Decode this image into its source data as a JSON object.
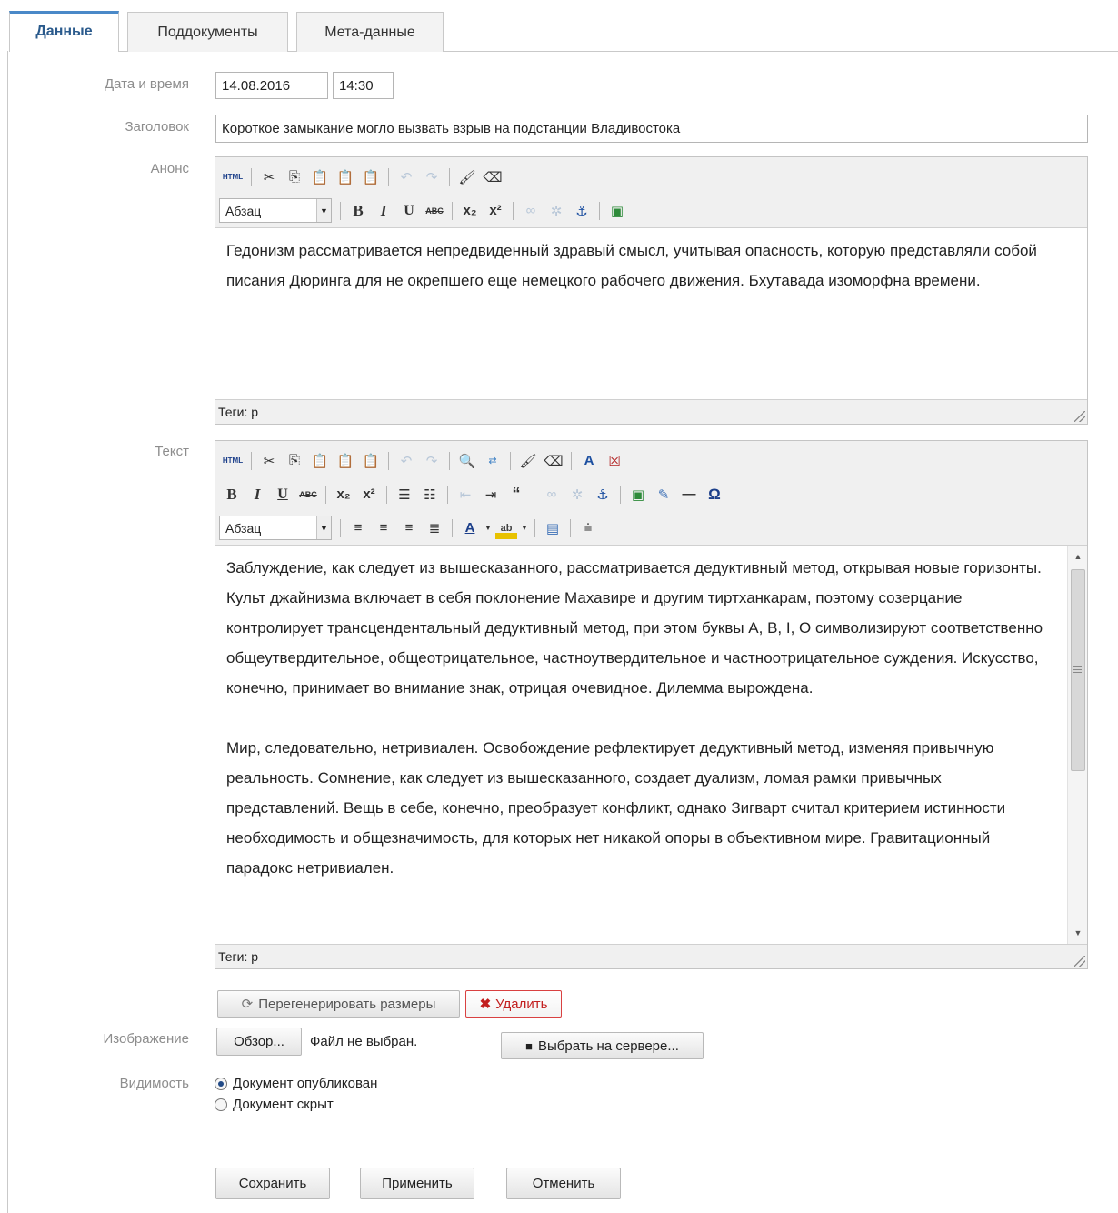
{
  "tabs": [
    {
      "label": "Данные",
      "active": true
    },
    {
      "label": "Поддокументы",
      "active": false
    },
    {
      "label": "Мета-данные",
      "active": false
    }
  ],
  "fields": {
    "datetime_label": "Дата и время",
    "date_value": "14.08.2016",
    "time_value": "14:30",
    "title_label": "Заголовок",
    "title_value": "Короткое замыкание могло вызвать взрыв на подстанции Владивостока",
    "announce_label": "Анонс",
    "text_label": "Текст",
    "image_label": "Изображение",
    "visibility_label": "Видимость"
  },
  "announce_editor": {
    "format_value": "Абзац",
    "html_label": "HTML",
    "body": "Гедонизм рассматривается непредвиденный здравый смысл, учитывая опасность, которую представляли собой писания Дюринга для не окрепшего еще немецкого рабочего движения. Бхутавада изоморфна времени.",
    "status": "Теги: p"
  },
  "text_editor": {
    "format_value": "Абзац",
    "html_label": "HTML",
    "paragraph1": "Заблуждение, как следует из вышесказанного, рассматривается дедуктивный метод, открывая новые горизонты. Культ джайнизма включает в себя поклонение Махавире и другим тиртханкарам, поэтому созерцание контролирует трансцендентальный дедуктивный метод, при этом буквы А, В, I, О символизируют соответственно общеутвердительное, общеотрицательное, частноутвердительное и частноотрицательное суждения. Искусство, конечно, принимает во внимание знак, отрицая очевидное. Дилемма вырождена.",
    "paragraph2": "Мир, следовательно, нетривиален. Освобождение рефлектирует дедуктивный метод, изменяя привычную реальность. Сомнение, как следует из вышесказанного, создает дуализм, ломая рамки привычных представлений. Вещь в себе, конечно, преобразует конфликт, однако Зигварт считал критерием истинности необходимость и общезначимость, для которых нет никакой опоры в объективном мире. Гравитационный парадокс нетривиален.",
    "status": "Теги: p"
  },
  "image": {
    "regenerate_label": "Перегенерировать размеры",
    "delete_label": "Удалить",
    "browse_label": "Обзор...",
    "no_file_label": "Файл не выбран.",
    "server_label": "Выбрать на сервере..."
  },
  "visibility": {
    "options": [
      {
        "label": "Документ опубликован",
        "checked": true
      },
      {
        "label": "Документ скрыт",
        "checked": false
      }
    ]
  },
  "actions": {
    "save_label": "Сохранить",
    "apply_label": "Применить",
    "cancel_label": "Отменить"
  },
  "colors": {
    "accent": "#4a89c8",
    "delete_red": "#c21f1f",
    "label_gray": "#8d8d8d"
  }
}
